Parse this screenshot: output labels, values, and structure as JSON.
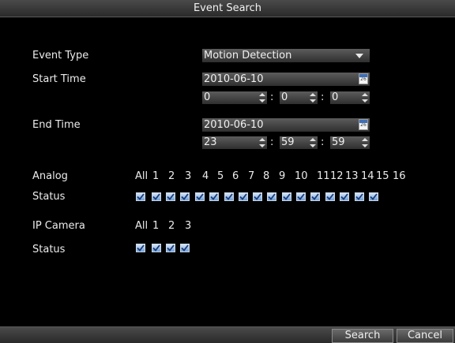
{
  "window": {
    "title": "Event Search"
  },
  "event_type": {
    "label": "Event Type",
    "value": "Motion Detection"
  },
  "start_time": {
    "label": "Start Time",
    "date": "2010-06-10",
    "hour": "0",
    "minute": "0",
    "second": "0",
    "calendar_icon_text": "26"
  },
  "end_time": {
    "label": "End Time",
    "date": "2010-06-10",
    "hour": "23",
    "minute": "59",
    "second": "59",
    "calendar_icon_text": "26"
  },
  "analog": {
    "label": "Analog",
    "all_label": "All",
    "channels": [
      "1",
      "2",
      "3",
      "4",
      "5",
      "6",
      "7",
      "8",
      "9",
      "10",
      "11",
      "12",
      "13",
      "14",
      "15",
      "16"
    ],
    "status_label": "Status",
    "all_checked": true,
    "checked": [
      true,
      true,
      true,
      true,
      true,
      true,
      true,
      true,
      true,
      true,
      true,
      true,
      true,
      true,
      true,
      true
    ]
  },
  "ip_camera": {
    "label": "IP Camera",
    "all_label": "All",
    "channels": [
      "1",
      "2",
      "3"
    ],
    "status_label": "Status",
    "all_checked": true,
    "checked": [
      true,
      true,
      true
    ]
  },
  "buttons": {
    "search": "Search",
    "cancel": "Cancel"
  },
  "colors": {
    "checkbox": "#6e9fd8",
    "title_bar": "#3a3a3a",
    "background": "#000000"
  }
}
